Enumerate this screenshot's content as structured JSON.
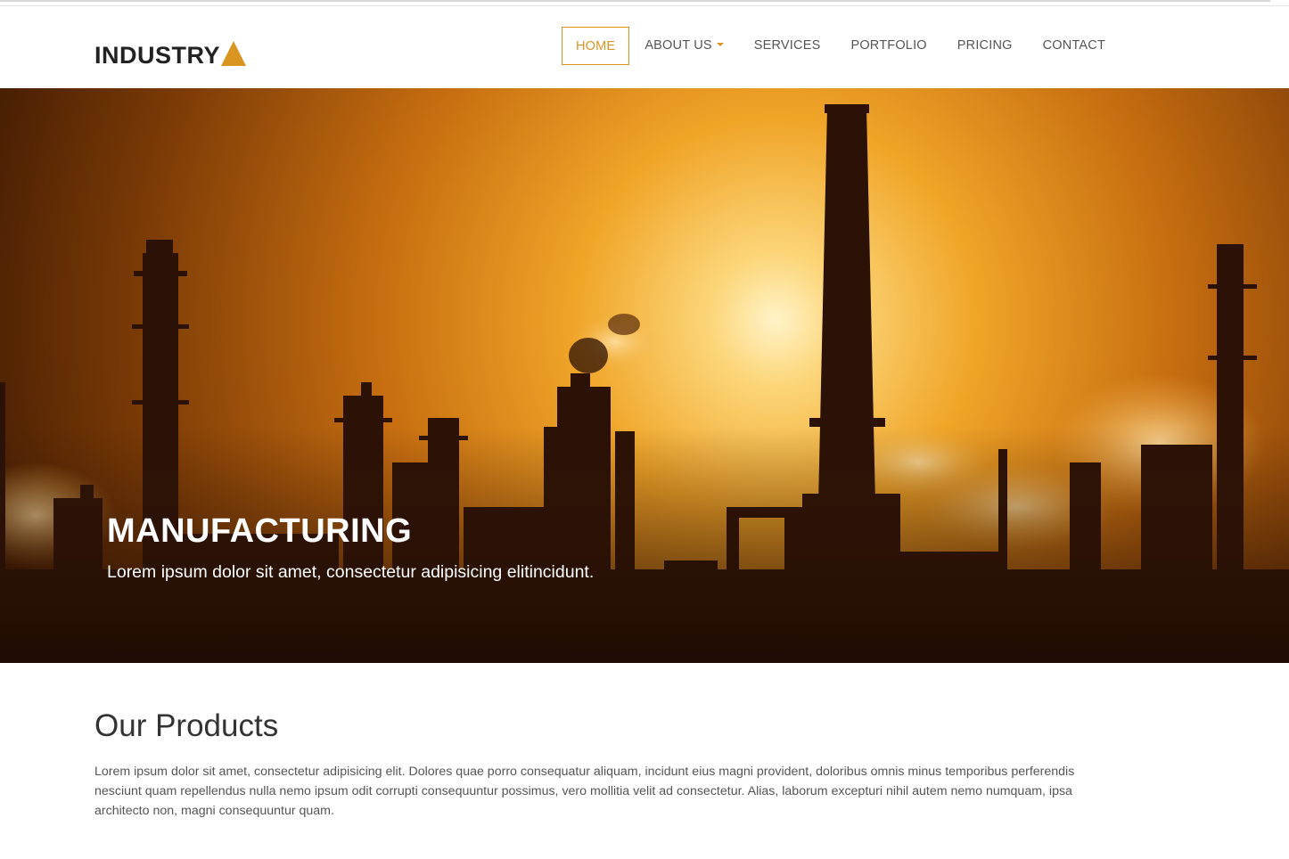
{
  "brand": {
    "name": "INDUSTRY",
    "accent_color": "#d9951f"
  },
  "nav": {
    "items": [
      {
        "label": "HOME",
        "active": true
      },
      {
        "label": "ABOUT US",
        "dropdown": true
      },
      {
        "label": "SERVICES"
      },
      {
        "label": "PORTFOLIO"
      },
      {
        "label": "PRICING"
      },
      {
        "label": "CONTACT"
      }
    ]
  },
  "hero": {
    "title": "MANUFACTURING",
    "subtitle": "Lorem ipsum dolor sit amet, consectetur adipisicing elitincidunt."
  },
  "products": {
    "title": "Our Products",
    "text": "Lorem ipsum dolor sit amet, consectetur adipisicing elit. Dolores quae porro consequatur aliquam, incidunt eius magni provident, doloribus omnis minus temporibus perferendis nesciunt quam repellendus nulla nemo ipsum odit corrupti consequuntur possimus, vero mollitia velit ad consectetur. Alias, laborum excepturi nihil autem nemo numquam, ipsa architecto non, magni consequuntur quam."
  }
}
